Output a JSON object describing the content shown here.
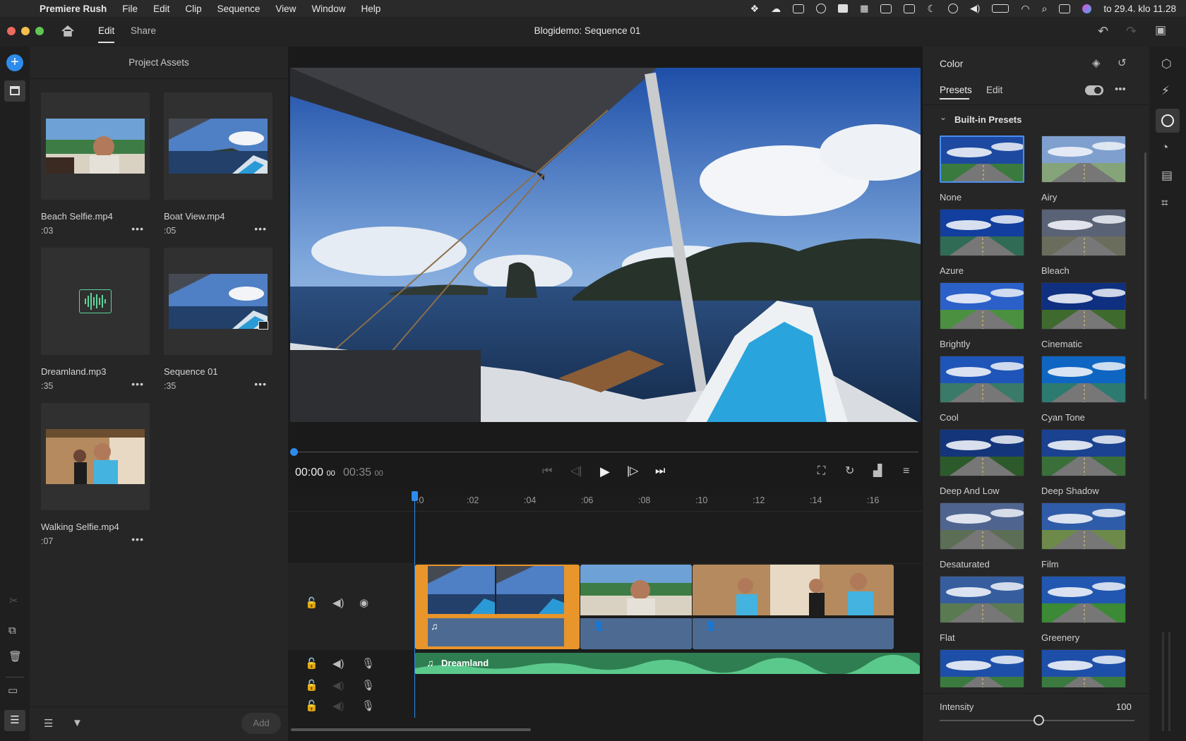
{
  "menubar": {
    "app": "Premiere Rush",
    "items": [
      "File",
      "Edit",
      "Clip",
      "Sequence",
      "View",
      "Window",
      "Help"
    ],
    "clock": "to 29.4. klo  11.28"
  },
  "titlebar": {
    "title": "Blogidemo: Sequence 01",
    "tabs": {
      "edit": "Edit",
      "share": "Share"
    }
  },
  "assets": {
    "header": "Project Assets",
    "items": [
      {
        "name": "Beach Selfie.mp4",
        "duration": ":03"
      },
      {
        "name": "Boat View.mp4",
        "duration": ":05"
      },
      {
        "name": "Dreamland.mp3",
        "duration": ":35"
      },
      {
        "name": "Sequence 01",
        "duration": ":35"
      },
      {
        "name": "Walking Selfie.mp4",
        "duration": ":07"
      }
    ],
    "add_label": "Add"
  },
  "player": {
    "current_time": "00:00",
    "current_frames": "00",
    "total_time": "00:35",
    "total_frames": "00"
  },
  "timeline": {
    "ruler": [
      ":0",
      ":02",
      ":04",
      ":06",
      ":08",
      ":10",
      ":12",
      ":14",
      ":16"
    ],
    "audio_track_name": "Dreamland",
    "playhead_fraction": 0.0
  },
  "color_panel": {
    "title": "Color",
    "tabs": {
      "presets": "Presets",
      "edit": "Edit"
    },
    "section": "Built-in Presets",
    "presets": [
      "None",
      "Airy",
      "Azure",
      "Bleach",
      "Brightly",
      "Cinematic",
      "Cool",
      "Cyan Tone",
      "Deep And Low",
      "Deep Shadow",
      "Desaturated",
      "Film",
      "Flat",
      "Greenery",
      "",
      ""
    ],
    "selected_preset": "None",
    "intensity_label": "Intensity",
    "intensity_value": "100"
  },
  "colors": {
    "accent": "#4a8ef0",
    "clip_selected": "#e8952b",
    "audio_music": "#3fa66b"
  }
}
